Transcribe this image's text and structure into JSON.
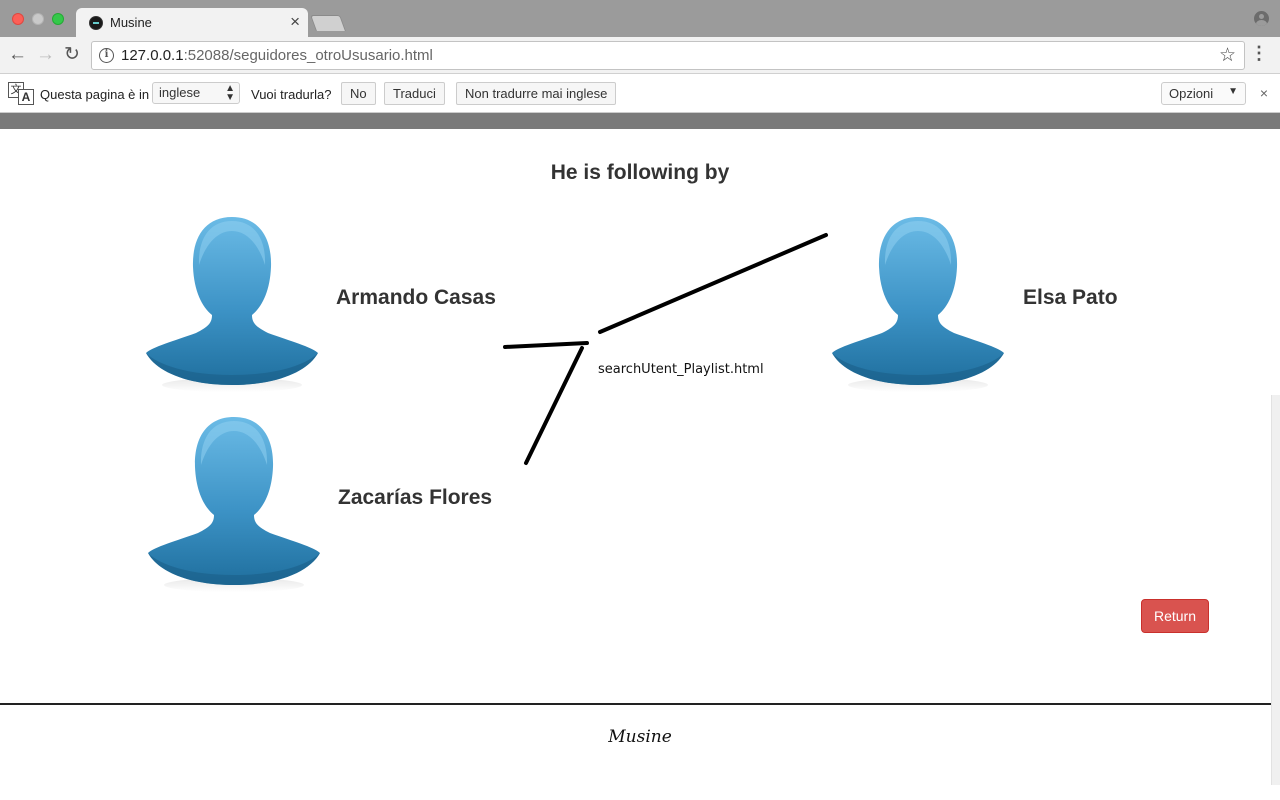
{
  "browser": {
    "tab_title": "Musine",
    "tab_close": "×",
    "url_host": "127.0.0.1",
    "url_rest": ":52088/seguidores_otroUsusario.html",
    "nav": {
      "back": "←",
      "forward": "→",
      "reload": "↻"
    },
    "star": "☆",
    "menu": "⋮"
  },
  "translate_bar": {
    "icon_glyph_1": "文",
    "icon_glyph_2": "A",
    "prefix": "Questa pagina è in",
    "language": "inglese",
    "question": "Vuoi tradurla?",
    "no_button": "No",
    "translate_button": "Traduci",
    "never_button": "Non tradurre mai inglese",
    "options": "Opzioni",
    "close": "×"
  },
  "page": {
    "title": "He is following by",
    "followers": [
      {
        "name": "Armando Casas"
      },
      {
        "name": "Elsa Pato"
      },
      {
        "name": "Zacarías Flores"
      }
    ],
    "annotation": "searchUtent_Playlist.html",
    "return_button": "Return"
  },
  "footer": {
    "brand": "Musine"
  },
  "colors": {
    "avatar_top": "#5aaedc",
    "avatar_bottom": "#2278a8",
    "return_button": "#d9534f"
  }
}
